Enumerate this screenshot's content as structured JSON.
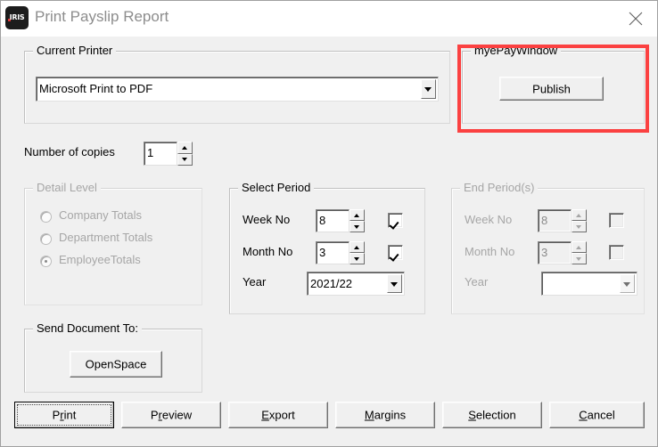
{
  "window": {
    "title": "Print Payslip Report",
    "logo_text": "IRIS",
    "logo_icon": "iris-logo-icon",
    "close_icon": "close-icon"
  },
  "colors": {
    "dialog_face": "#f0f0f0",
    "titlebar": "#ffffff",
    "title_text": "#8d8d8d",
    "highlight": "#fb4141",
    "disabled_text": "#a6a6a6"
  },
  "current_printer": {
    "group_label": "Current Printer",
    "printer_value": "Microsoft Print to PDF",
    "dropdown_icon": "chevron-down-icon"
  },
  "mypaywindow": {
    "group_label": "myePayWindow",
    "publish_label": "Publish",
    "highlighted": true
  },
  "copies": {
    "label": "Number of copies",
    "value": "1",
    "spinner_up_icon": "caret-up-icon",
    "spinner_down_icon": "caret-down-icon"
  },
  "detail_level": {
    "group_label": "Detail Level",
    "disabled": true,
    "options": [
      {
        "label": "Company Totals",
        "selected": false
      },
      {
        "label": "Department Totals",
        "selected": false
      },
      {
        "label": "EmployeeTotals",
        "selected": true
      }
    ]
  },
  "select_period": {
    "group_label": "Select Period",
    "disabled": false,
    "week_label": "Week No",
    "week_value": "8",
    "week_checked": true,
    "month_label": "Month No",
    "month_value": "3",
    "month_checked": true,
    "year_label": "Year",
    "year_value": "2021/22",
    "dropdown_icon": "chevron-down-icon"
  },
  "end_period": {
    "group_label": "End Period(s)",
    "disabled": true,
    "week_label": "Week No",
    "week_value": "8",
    "week_checked": false,
    "month_label": "Month No",
    "month_value": "3",
    "month_checked": false,
    "year_label": "Year",
    "year_value": "",
    "dropdown_icon": "chevron-down-icon"
  },
  "send_document": {
    "group_label": "Send Document To:",
    "openspace_label": "OpenSpace"
  },
  "buttons": [
    {
      "name": "print",
      "pre": "P",
      "accel": "r",
      "post": "int",
      "default": true
    },
    {
      "name": "preview",
      "pre": "P",
      "accel": "r",
      "post": "eview",
      "default": false
    },
    {
      "name": "export",
      "pre": "",
      "accel": "E",
      "post": "xport",
      "default": false
    },
    {
      "name": "margins",
      "pre": "",
      "accel": "M",
      "post": "argins",
      "default": false
    },
    {
      "name": "selection",
      "pre": "",
      "accel": "S",
      "post": "election",
      "default": false
    },
    {
      "name": "cancel",
      "pre": "",
      "accel": "C",
      "post": "ancel",
      "default": false
    }
  ],
  "button_labels": {
    "print": "Print",
    "preview": "Preview",
    "export": "Export",
    "margins": "Margins",
    "selection": "Selection",
    "cancel": "Cancel"
  }
}
